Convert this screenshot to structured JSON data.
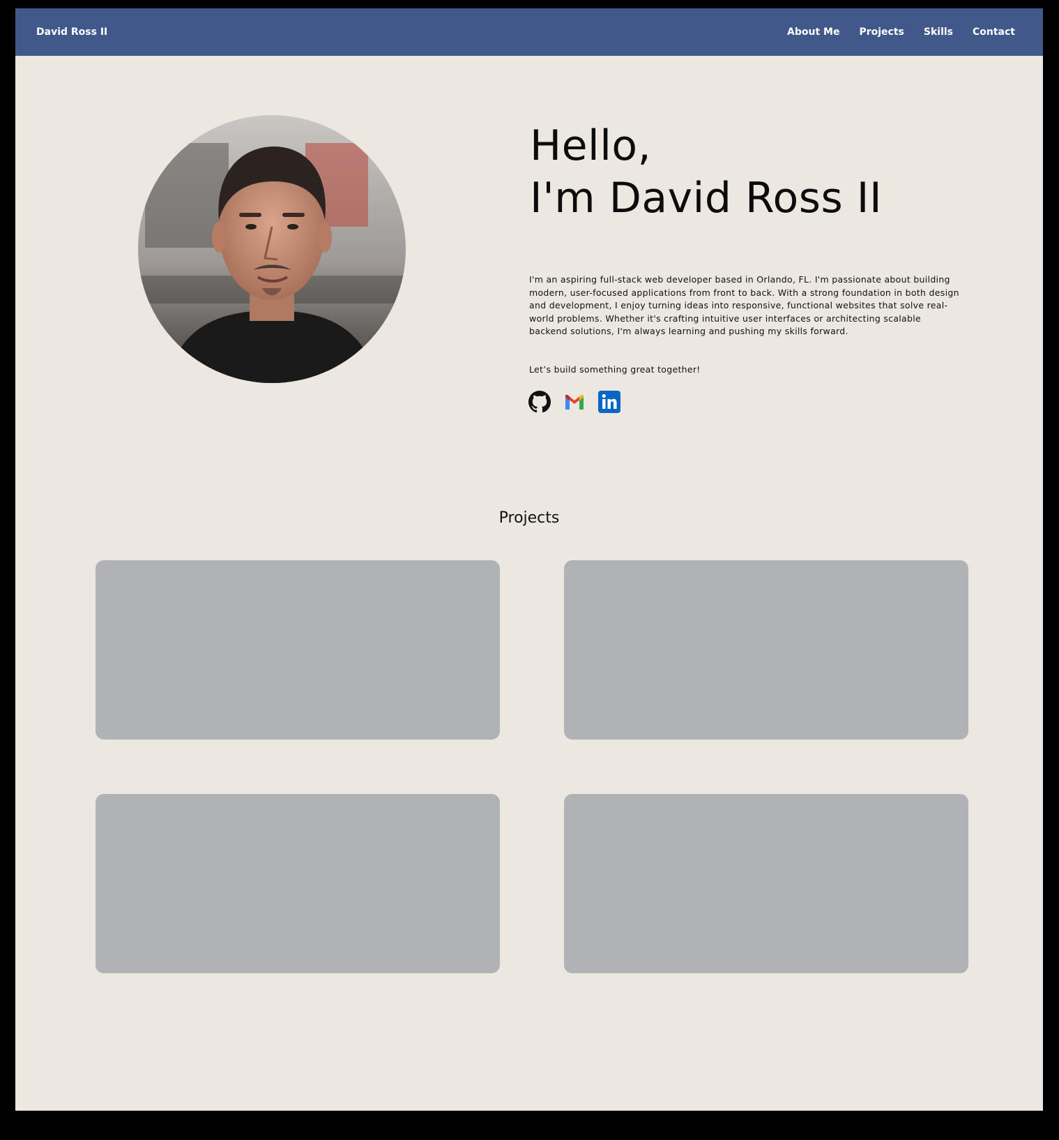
{
  "nav": {
    "brand": "David Ross II",
    "links": [
      "About Me",
      "Projects",
      "Skills",
      "Contact"
    ]
  },
  "hero": {
    "greeting": "Hello,",
    "name_line": "I'm David Ross II",
    "bio": "I'm an aspiring full-stack web developer based in Orlando, FL. I'm passionate about building modern, user-focused applications from front to back. With a strong foundation in both design and development, I enjoy turning ideas into responsive, functional websites that solve real-world problems. Whether it's crafting intuitive user interfaces or architecting scalable backend solutions, I'm always learning and pushing my skills forward.",
    "cta": "Let’s build something great together!",
    "socials": [
      "github-icon",
      "gmail-icon",
      "linkedin-icon"
    ]
  },
  "projects": {
    "title": "Projects",
    "cards": [
      "",
      "",
      "",
      ""
    ]
  },
  "colors": {
    "nav_bg": "#40598A",
    "page_bg": "#ECE7E1",
    "card_bg": "#B1B2B5",
    "linkedin": "#0A66C2"
  }
}
